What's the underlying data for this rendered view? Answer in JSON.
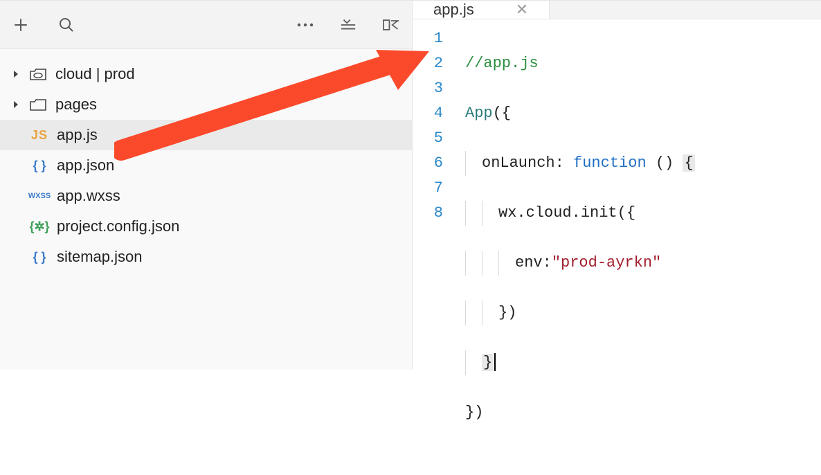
{
  "tree": {
    "items": [
      {
        "label": "cloud | prod",
        "icon": "cloud-folder",
        "expandable": true
      },
      {
        "label": "pages",
        "icon": "folder",
        "expandable": true
      },
      {
        "label": "app.js",
        "icon": "js",
        "selected": true
      },
      {
        "label": "app.json",
        "icon": "json"
      },
      {
        "label": "app.wxss",
        "icon": "wxss"
      },
      {
        "label": "project.config.json",
        "icon": "config"
      },
      {
        "label": "sitemap.json",
        "icon": "json"
      }
    ],
    "icon_text": {
      "js": "JS",
      "json": "{ }",
      "wxss": "WXSS",
      "config": "{✲}"
    }
  },
  "tabs": [
    {
      "label": "app.js",
      "active": true
    }
  ],
  "code": {
    "lines": [
      "1",
      "2",
      "3",
      "4",
      "5",
      "6",
      "7",
      "8"
    ],
    "l1_comment": "//app.js",
    "l2_app": "App",
    "l2_rest": "({",
    "l3_key": "onLaunch",
    "l3_colon": ": ",
    "l3_func": "function",
    "l3_rest": " () ",
    "l3_brace": "{",
    "l4_text": "wx.cloud.init({",
    "l5_key": "env",
    "l5_colon": ":",
    "l5_str": "\"prod-ayrkn\"",
    "l6_text": "})",
    "l7_brace": "}",
    "l8_text": "})"
  }
}
